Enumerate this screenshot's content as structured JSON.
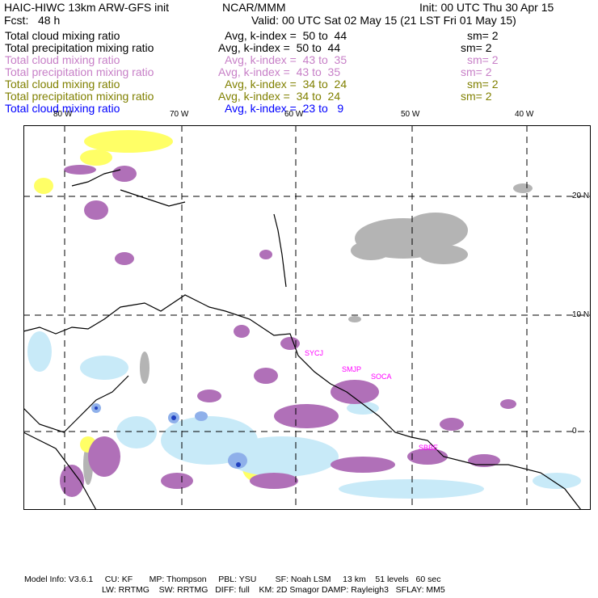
{
  "header": {
    "title": "HAIC-HIWC 13km ARW-GFS init",
    "org": "NCAR/MMM",
    "init": "Init: 00 UTC Thu 30 Apr 15",
    "fcst": "Fcst:   48 h",
    "valid": "Valid: 00 UTC Sat 02 May 15 (21 LST Fri 01 May 15)"
  },
  "fields": [
    {
      "name": "Total cloud mixing ratio",
      "avg": "Avg, k-index =  50 to  44",
      "sm": "sm= 2",
      "color": "#000000"
    },
    {
      "name": "Total precipitation mixing ratio",
      "avg": "Avg, k-index =  50 to  44",
      "sm": "sm= 2",
      "color": "#000000"
    },
    {
      "name": "Total cloud mixing ratio",
      "avg": "Avg, k-index =  43 to  35",
      "sm": "sm= 2",
      "color": "#c77fc7"
    },
    {
      "name": "Total precipitation mixing ratio",
      "avg": "Avg, k-index =  43 to  35",
      "sm": "sm= 2",
      "color": "#c77fc7"
    },
    {
      "name": "Total cloud mixing ratio",
      "avg": "Avg, k-index =  34 to  24",
      "sm": "sm= 2",
      "color": "#808000"
    },
    {
      "name": "Total precipitation mixing ratio",
      "avg": "Avg, k-index =  34 to  24",
      "sm": "sm= 2",
      "color": "#808000"
    },
    {
      "name": "Total cloud mixing ratio",
      "avg": "Avg, k-index =  23 to   9",
      "color": "#0000ff"
    }
  ],
  "map": {
    "lon_labels": [
      "80 W",
      "70 W",
      "60 W",
      "50 W",
      "40 W"
    ],
    "lat_labels": [
      "20 N",
      "10 N",
      "0"
    ],
    "stations": [
      "SYCJ",
      "SMJP",
      "SOCA",
      "SBBE"
    ]
  },
  "footer": {
    "line1": "Model Info: V3.6.1     CU: KF       MP: Thompson     PBL: YSU        SF: Noah LSM     13 km    51 levels   60 sec",
    "line2": "LW: RRTMG    SW: RRTMG   DIFF: full    KM: 2D Smagor DAMP: Rayleigh3   SFLAY: MM5"
  }
}
